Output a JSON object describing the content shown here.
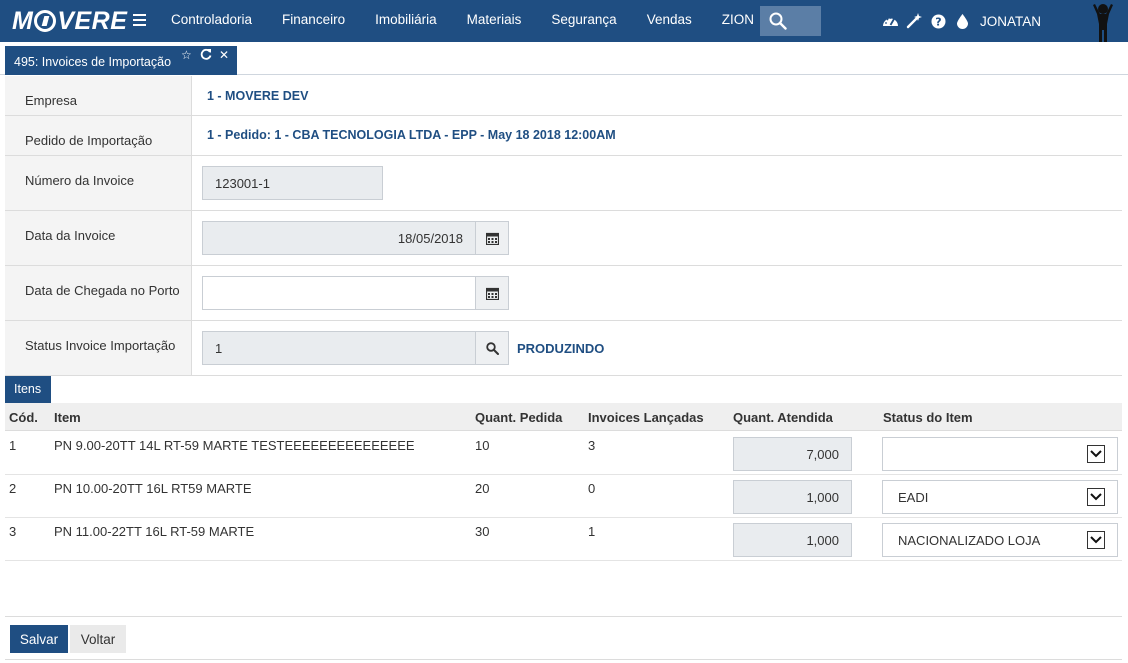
{
  "brand": {
    "logo_text_left": "M",
    "logo_text_right": "VERE"
  },
  "nav": {
    "menu": [
      "Controladoria",
      "Financeiro",
      "Imobiliária",
      "Materiais",
      "Segurança",
      "Vendas",
      "ZION"
    ],
    "user": "JONATAN",
    "icons": [
      "dashboard-icon",
      "magic-wand-icon",
      "help-icon",
      "drop-icon"
    ]
  },
  "tab": {
    "title": "495: Invoices de Importação"
  },
  "form": {
    "empresa": {
      "label": "Empresa",
      "value": "1 - MOVERE DEV"
    },
    "pedido": {
      "label": "Pedido de Importação",
      "value": "1 - Pedido: 1 - CBA TECNOLOGIA LTDA - EPP - May 18 2018 12:00AM"
    },
    "numero": {
      "label": "Número da Invoice",
      "value": "123001-1"
    },
    "data_invoice": {
      "label": "Data da Invoice",
      "value": "18/05/2018"
    },
    "data_chegada": {
      "label": "Data de Chegada no Porto",
      "value": ""
    },
    "status": {
      "label": "Status Invoice Importação",
      "value": "1",
      "desc": "PRODUZINDO"
    }
  },
  "items": {
    "tab_label": "Itens",
    "headers": {
      "cod": "Cód.",
      "item": "Item",
      "qpedida": "Quant. Pedida",
      "invoices": "Invoices Lançadas",
      "qatendida": "Quant. Atendida",
      "status": "Status do Item"
    },
    "rows": [
      {
        "cod": "1",
        "item": "PN 9.00-20TT 14L RT-59 MARTE TESTEEEEEEEEEEEEEEE",
        "qpedida": "10",
        "invoices": "3",
        "qatendida": "7,000",
        "status": ""
      },
      {
        "cod": "2",
        "item": "PN 10.00-20TT 16L RT59 MARTE",
        "qpedida": "20",
        "invoices": "0",
        "qatendida": "1,000",
        "status": "EADI"
      },
      {
        "cod": "3",
        "item": "PN 11.00-22TT 16L RT-59 MARTE",
        "qpedida": "30",
        "invoices": "1",
        "qatendida": "1,000",
        "status": "NACIONALIZADO LOJA"
      }
    ]
  },
  "footer": {
    "save": "Salvar",
    "back": "Voltar"
  }
}
